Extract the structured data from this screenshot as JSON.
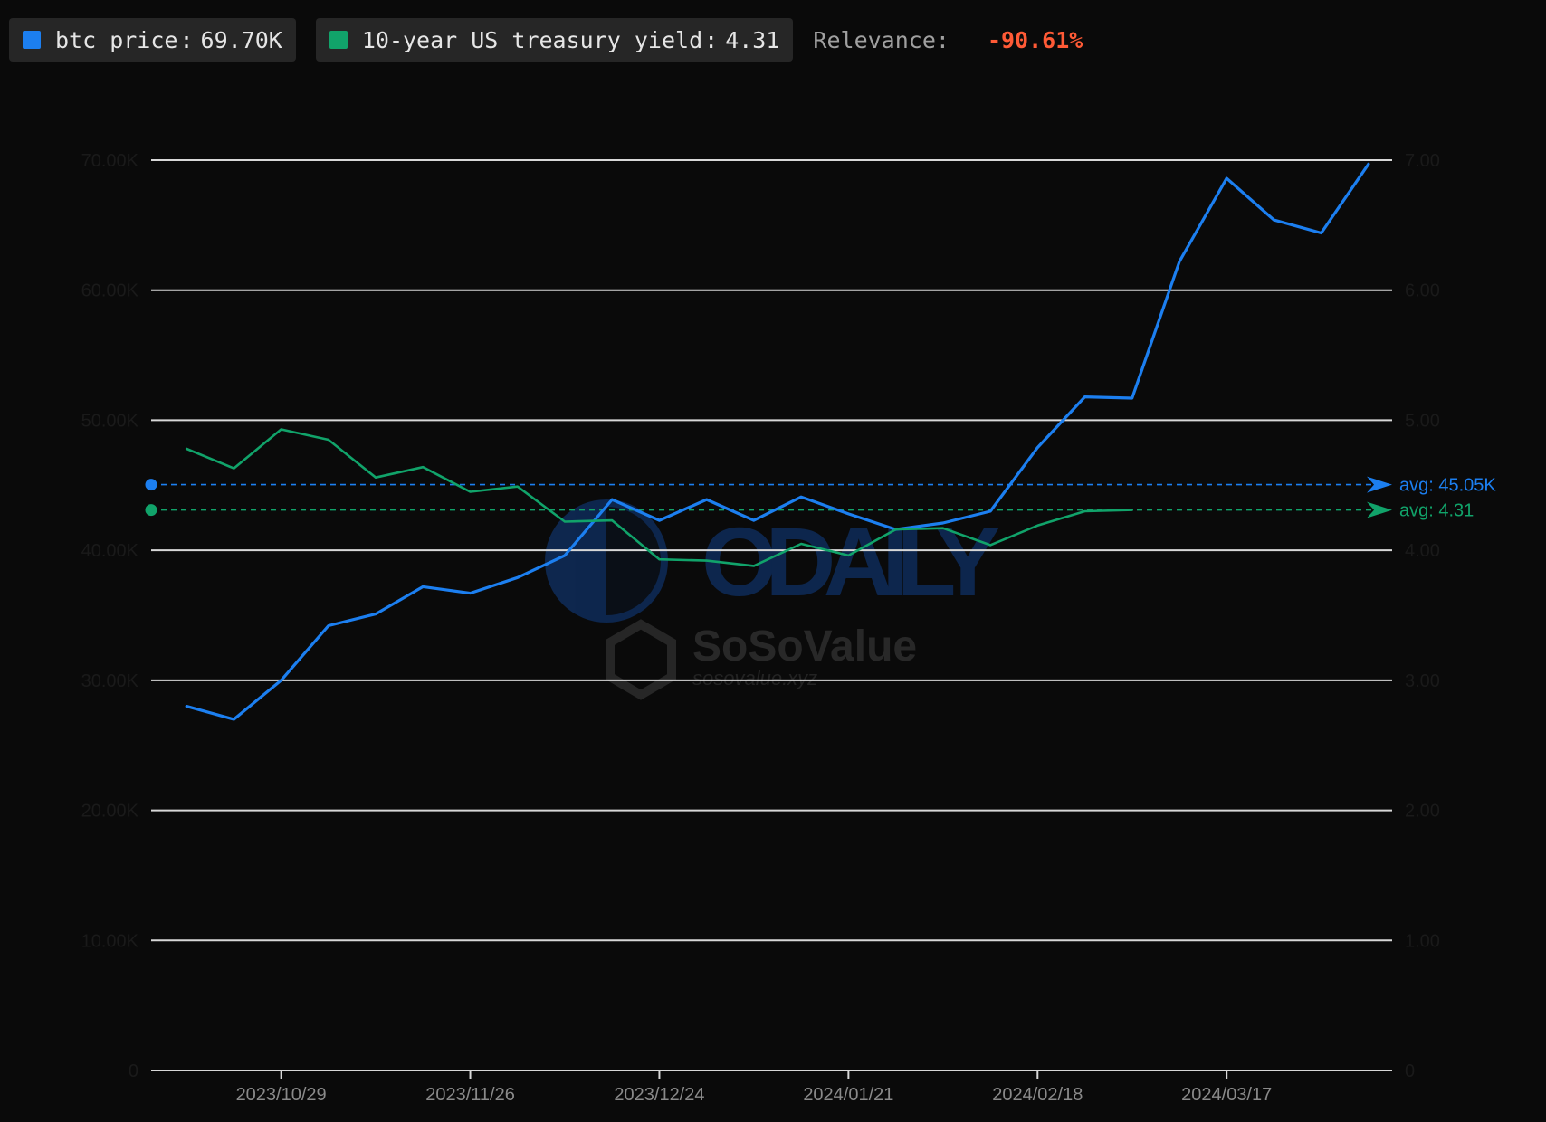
{
  "legend": {
    "btc": {
      "label": "btc price",
      "value": "69.70K",
      "color": "#1c7ff0"
    },
    "yield": {
      "label": "10-year US treasury yield",
      "value": "4.31",
      "color": "#11a36a"
    },
    "relevance_label": "Relevance:",
    "relevance_value": "-90.61%"
  },
  "colors": {
    "background": "#0a0a0a",
    "grid": "#d8d8d8",
    "tick_text": "#1a1a1a",
    "x_tick_text": "#8a8a8a",
    "relevance": "#ff5a36"
  },
  "watermark": {
    "brand1": "ODAILY",
    "brand2": "SoSoValue",
    "brand2_url": "sosovalue.xyz"
  },
  "chart_data": {
    "type": "line",
    "x": [
      "2023/10/15",
      "2023/10/22",
      "2023/10/29",
      "2023/11/05",
      "2023/11/12",
      "2023/11/19",
      "2023/11/26",
      "2023/12/03",
      "2023/12/10",
      "2023/12/17",
      "2023/12/24",
      "2023/12/31",
      "2024/01/07",
      "2024/01/14",
      "2024/01/21",
      "2024/01/28",
      "2024/02/04",
      "2024/02/11",
      "2024/02/18",
      "2024/02/25",
      "2024/03/03",
      "2024/03/10",
      "2024/03/17",
      "2024/03/24",
      "2024/03/31",
      "2024/04/07"
    ],
    "x_ticks": [
      "2023/10/29",
      "2023/11/26",
      "2023/12/24",
      "2024/01/21",
      "2024/02/18",
      "2024/03/17"
    ],
    "left_axis": {
      "ticks": [
        "0",
        "10.00K",
        "20.00K",
        "30.00K",
        "40.00K",
        "50.00K",
        "60.00K",
        "70.00K"
      ],
      "ylim": [
        0,
        70000
      ]
    },
    "right_axis": {
      "ticks": [
        "0",
        "1.00",
        "2.00",
        "3.00",
        "4.00",
        "5.00",
        "6.00",
        "7.00"
      ],
      "ylim": [
        0,
        7
      ]
    },
    "grid": true,
    "series": [
      {
        "name": "btc price",
        "axis": "left",
        "values": [
          28000,
          27000,
          30000,
          34200,
          35100,
          37200,
          36700,
          37900,
          39600,
          43900,
          42300,
          43900,
          42300,
          44100,
          42800,
          41600,
          42100,
          43000,
          47900,
          51800,
          51700,
          62200,
          68600,
          65400,
          64400,
          69700
        ],
        "avg_label": "avg: 45.05K",
        "avg": 45050
      },
      {
        "name": "10-year US treasury yield",
        "axis": "right",
        "values": [
          4.78,
          4.63,
          4.93,
          4.85,
          4.56,
          4.64,
          4.45,
          4.49,
          4.22,
          4.23,
          3.93,
          3.92,
          3.88,
          4.05,
          3.96,
          4.16,
          4.17,
          4.04,
          4.19,
          4.3,
          4.31,
          null,
          null,
          null,
          null,
          null
        ],
        "avg_label": "avg: 4.31",
        "avg": 4.31
      }
    ]
  }
}
